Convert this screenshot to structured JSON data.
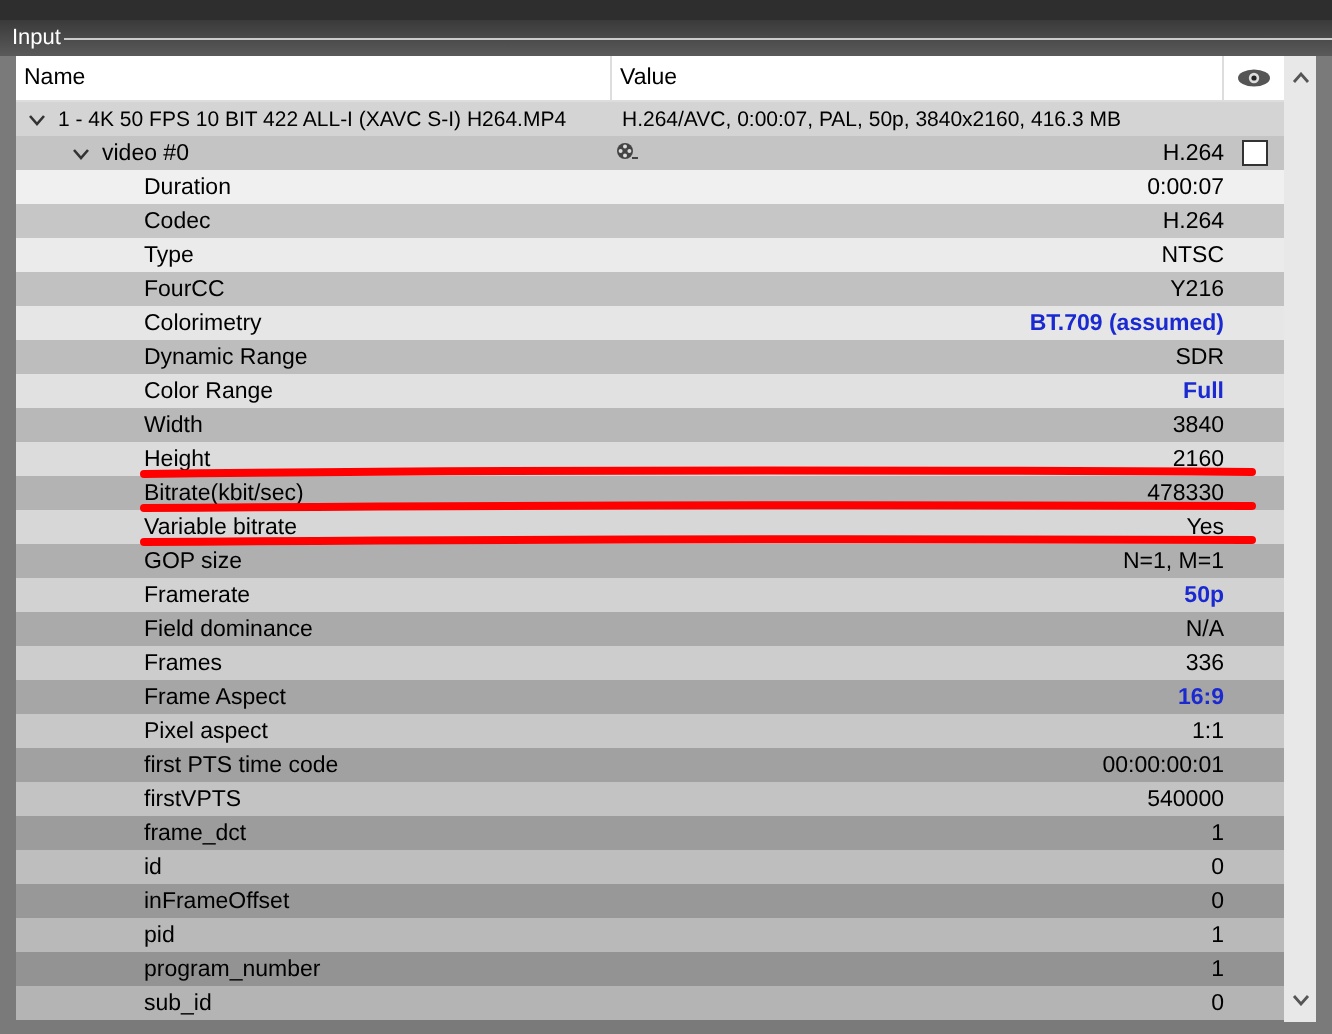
{
  "group_title": "Input",
  "columns": [
    "Name",
    "Value"
  ],
  "file": {
    "name": "1 - 4K 50 FPS 10 BIT 422 ALL-I (XAVC S-I) H264.MP4",
    "value": "H.264/AVC, 0:00:07, PAL, 50p, 3840x2160, 416.3 MB",
    "expanded": true
  },
  "stream": {
    "name": "video #0",
    "value": "H.264",
    "expanded": true,
    "checked": false
  },
  "properties": [
    {
      "name": "Duration",
      "value": "0:00:07",
      "highlight": false
    },
    {
      "name": "Codec",
      "value": "H.264",
      "highlight": false
    },
    {
      "name": "Type",
      "value": "NTSC",
      "highlight": false
    },
    {
      "name": "FourCC",
      "value": "Y216",
      "highlight": false
    },
    {
      "name": "Colorimetry",
      "value": "BT.709 (assumed)",
      "highlight": true
    },
    {
      "name": "Dynamic Range",
      "value": "SDR",
      "highlight": false
    },
    {
      "name": "Color Range",
      "value": "Full",
      "highlight": true
    },
    {
      "name": "Width",
      "value": "3840",
      "highlight": false
    },
    {
      "name": "Height",
      "value": "2160",
      "highlight": false
    },
    {
      "name": "Bitrate(kbit/sec)",
      "value": "478330",
      "highlight": false
    },
    {
      "name": "Variable bitrate",
      "value": "Yes",
      "highlight": false
    },
    {
      "name": "GOP size",
      "value": "N=1, M=1",
      "highlight": false
    },
    {
      "name": "Framerate",
      "value": "50p",
      "highlight": true
    },
    {
      "name": "Field dominance",
      "value": "N/A",
      "highlight": false
    },
    {
      "name": "Frames",
      "value": "336",
      "highlight": false
    },
    {
      "name": "Frame Aspect",
      "value": "16:9",
      "highlight": true
    },
    {
      "name": "Pixel aspect",
      "value": "1:1",
      "highlight": false
    },
    {
      "name": "first PTS time code",
      "value": "00:00:00:01",
      "highlight": false
    },
    {
      "name": "firstVPTS",
      "value": "540000",
      "highlight": false
    },
    {
      "name": "frame_dct",
      "value": "1",
      "highlight": false
    },
    {
      "name": "id",
      "value": "0",
      "highlight": false
    },
    {
      "name": "inFrameOffset",
      "value": "0",
      "highlight": false
    },
    {
      "name": "pid",
      "value": "1",
      "highlight": false
    },
    {
      "name": "program_number",
      "value": "1",
      "highlight": false
    },
    {
      "name": "sub_id",
      "value": "0",
      "highlight": false
    }
  ]
}
